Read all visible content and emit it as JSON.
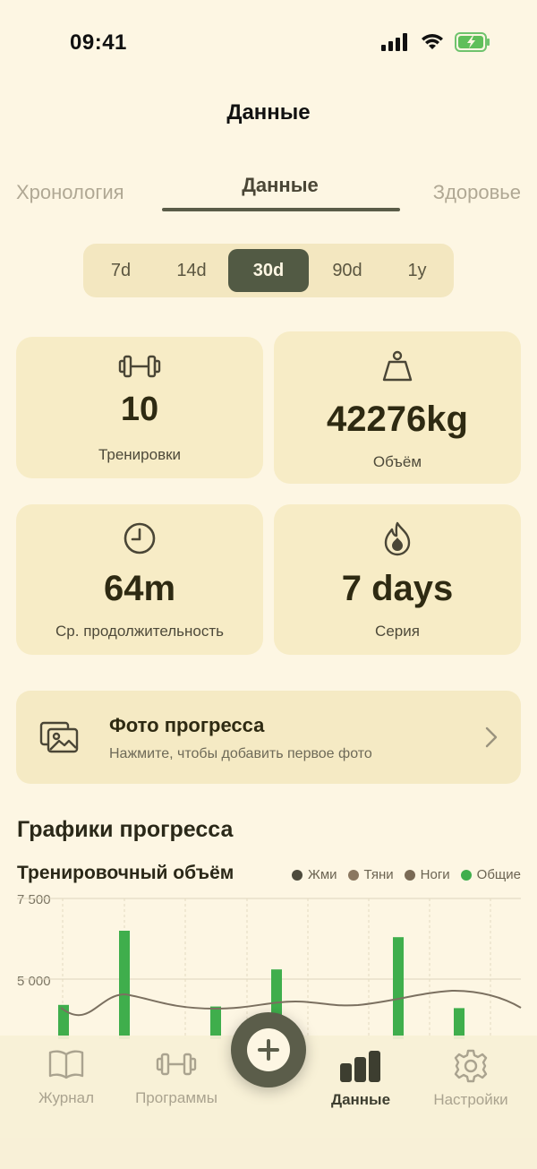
{
  "status_bar": {
    "time": "09:41"
  },
  "nav": {
    "title": "Данные"
  },
  "top_tabs": {
    "left": "Хронология",
    "center": "Данные",
    "right": "Здоровье"
  },
  "ranges": [
    "7d",
    "14d",
    "30d",
    "90d",
    "1y"
  ],
  "selected_range": "30d",
  "stats": {
    "workouts": {
      "value": "10",
      "label": "Тренировки",
      "icon": "dumbbell-icon"
    },
    "volume": {
      "value": "42276kg",
      "label": "Объём",
      "icon": "weight-icon"
    },
    "duration": {
      "value": "64m",
      "label": "Ср. продолжительность",
      "icon": "clock-icon"
    },
    "streak": {
      "value": "7 days",
      "label": "Серия",
      "icon": "flame-icon"
    }
  },
  "photo_card": {
    "title": "Фото прогресса",
    "subtitle": "Нажмите, чтобы добавить первое фото"
  },
  "progress": {
    "section_title": "Графики прогресса"
  },
  "chart_data": {
    "type": "bar",
    "title": "Тренировочный объём",
    "legend": [
      {
        "name": "Жми",
        "color": "#4d4a3c"
      },
      {
        "name": "Тяни",
        "color": "#8a7760"
      },
      {
        "name": "Ноги",
        "color": "#7a6a55"
      },
      {
        "name": "Общие",
        "color": "#3fae4c"
      }
    ],
    "y_ticks": [
      "7 500",
      "5 000"
    ],
    "ylim": [
      2500,
      7500
    ],
    "series": [
      {
        "name": "Общие",
        "values": [
          4200,
          6500,
          4150,
          5300,
          6300,
          4100
        ]
      }
    ],
    "trend_color": "#7b7060"
  },
  "tabbar": {
    "items": [
      {
        "label": "Журнал",
        "icon": "book-icon"
      },
      {
        "label": "Программы",
        "icon": "dumbbell-icon"
      },
      {
        "label": "Данные",
        "icon": "bar-chart-icon"
      },
      {
        "label": "Настройки",
        "icon": "gear-icon"
      }
    ]
  }
}
